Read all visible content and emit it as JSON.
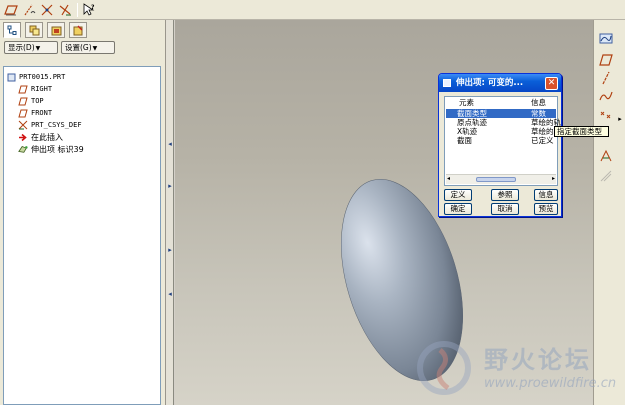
{
  "toolbar": {
    "icons": [
      "sketch-plane-icon",
      "sketch-curve-icon",
      "axis-datum-icon",
      "point-datum-icon",
      "help-pointer-icon"
    ]
  },
  "navigator": {
    "tabs": [
      "model-tree-tab",
      "layers-tab",
      "folder-browser-tab",
      "favorites-tab"
    ],
    "show_button": "显示(D)",
    "settings_button": "设置(G)",
    "tree": [
      {
        "label": "PRT0015.PRT",
        "icon": "part-icon"
      },
      {
        "label": "RIGHT",
        "icon": "datum-plane-icon"
      },
      {
        "label": "TOP",
        "icon": "datum-plane-icon"
      },
      {
        "label": "FRONT",
        "icon": "datum-plane-icon"
      },
      {
        "label": "PRT_CSYS_DEF",
        "icon": "csys-icon"
      },
      {
        "label": "在此插入",
        "icon": "insert-here-icon"
      },
      {
        "label": "伸出项 标识39",
        "icon": "protrusion-icon"
      }
    ]
  },
  "dialog": {
    "title": "伸出项: 可变的...",
    "columns": {
      "element": "元素",
      "info": "信息"
    },
    "rows": [
      {
        "element": "截面类型",
        "info": "常数",
        "selected": true
      },
      {
        "element": "原点轨迹",
        "info": "草绘的轨"
      },
      {
        "element": "X轨迹",
        "info": "草绘的轨"
      },
      {
        "element": "截面",
        "info": "已定义"
      }
    ],
    "buttons": {
      "define": "定义",
      "reference": "参照",
      "info": "信息",
      "ok": "确定",
      "cancel": "取消",
      "preview": "预览"
    }
  },
  "tooltip": "指定截面类型",
  "right_toolbar": {
    "icons": [
      "sketch-tool-icon",
      "datum-plane-icon",
      "datum-axis-icon",
      "datum-curve-icon",
      "datum-point-icon",
      "csys-icon",
      "analysis-icon"
    ]
  },
  "watermark": {
    "cn": "野火论坛",
    "url": "www.proewildfire.cn"
  }
}
